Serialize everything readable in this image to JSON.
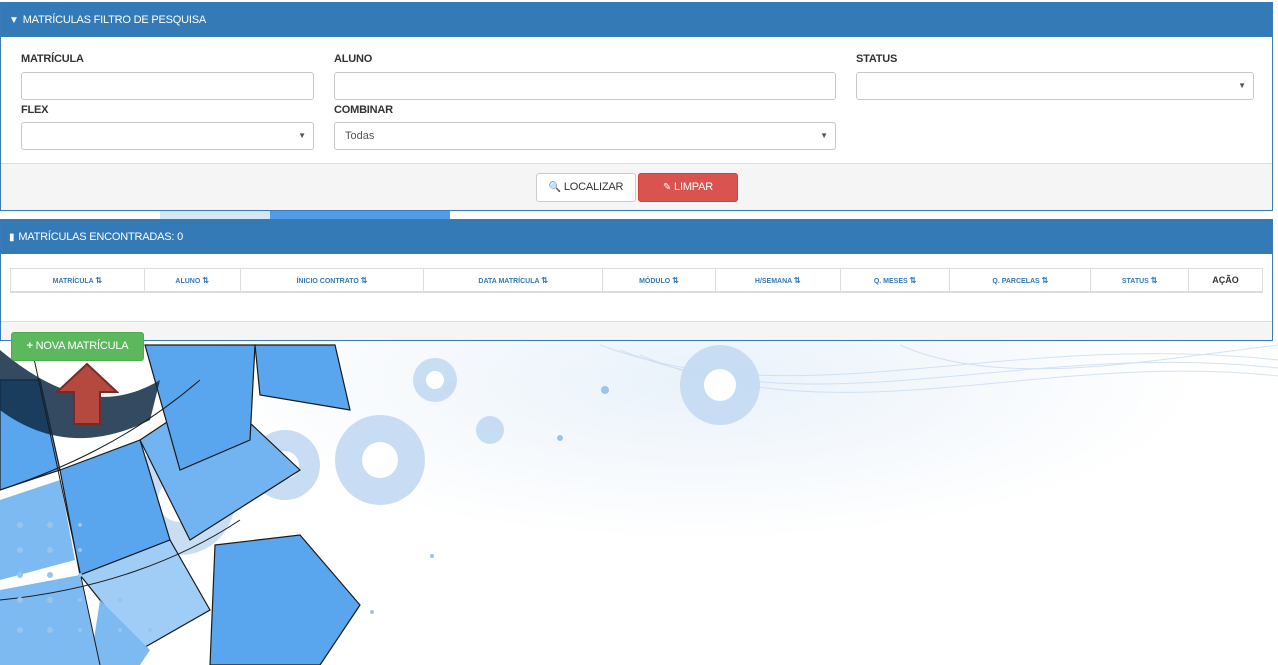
{
  "filter": {
    "title": "MATRÍCULAS FILTRO DE PESQUISA",
    "icon": "filter-icon",
    "matricula_label": "MATRÍCULA",
    "matricula_value": "",
    "aluno_label": "ALUNO",
    "aluno_value": "",
    "status_label": "STATUS",
    "status_value": "",
    "flex_label": "FLEX",
    "flex_value": "",
    "combinar_label": "COMBINAR",
    "combinar_value": "Todas",
    "localizar_label": "LOCALIZAR",
    "limpar_label": "LIMPAR"
  },
  "results": {
    "title": "MATRÍCULAS ENCONTRADAS: 0",
    "icon": "copy-icon",
    "columns": [
      "MATRÍCULA",
      "ALUNO",
      "ÍNICIO CONTRATO",
      "DATA MATRÍCULA",
      "MÓDULO",
      "H/SEMANA",
      "Q. MESES",
      "Q. PARCELAS",
      "STATUS",
      "AÇÃO"
    ]
  },
  "nova_matricula_label": "NOVA MATRÍCULA",
  "colors": {
    "primary": "#337ab7",
    "danger": "#d9534f",
    "success": "#5cb85c",
    "arrow": "#b5483f"
  }
}
